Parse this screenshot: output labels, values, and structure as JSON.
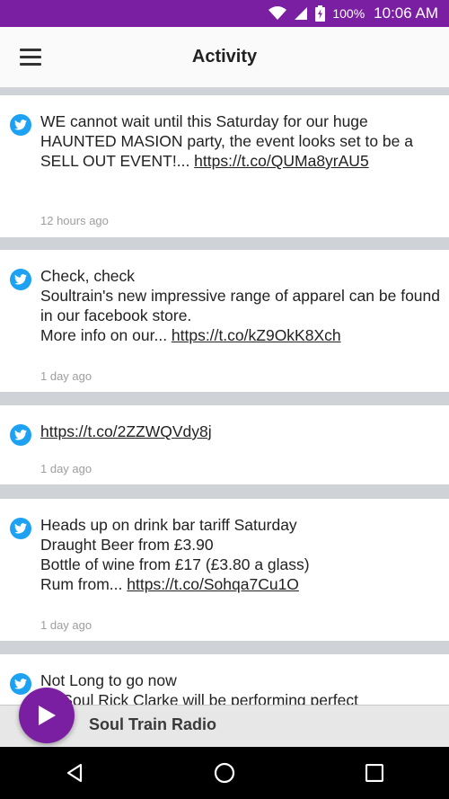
{
  "status_bar": {
    "battery": "100%",
    "time": "10:06 AM"
  },
  "app_bar": {
    "title": "Activity"
  },
  "feed": [
    {
      "text": "WE cannot wait until this Saturday for our huge HAUNTED MASION party, the event looks set to be a SELL OUT EVENT!... ",
      "link": "https://t.co/QUMa8yrAU5",
      "time": "12 hours ago"
    },
    {
      "lines": [
        "Check, check",
        "Soultrain's new impressive range of apparel can be found in our facebook store.",
        "More info on our... "
      ],
      "link": "https://t.co/kZ9OkK8Xch",
      "time": "1 day ago"
    },
    {
      "text": "",
      "link": "https://t.co/2ZZWQVdy8j",
      "time": "1 day ago"
    },
    {
      "lines": [
        "Heads up on drink bar tariff Saturday",
        "Draught Beer from £3.90",
        "Bottle of wine from £17 (£3.80 a glass)",
        "Rum from... "
      ],
      "link": "https://t.co/Sohqa7Cu1O",
      "time": "1 day ago"
    },
    {
      "lines": [
        "Not Long to go now",
        "...t Soul Rick Clarke will be performing perfect"
      ]
    }
  ],
  "player": {
    "station": "Soul Train Radio"
  },
  "colors": {
    "status_bar": "#7b1fa2",
    "play_button": "#7b1fa2",
    "twitter": "#1da1f2"
  },
  "icons": [
    "wifi-icon",
    "signal-icon",
    "battery-icon",
    "menu-icon",
    "twitter-icon",
    "play-icon",
    "back-icon",
    "home-icon",
    "recents-icon"
  ]
}
